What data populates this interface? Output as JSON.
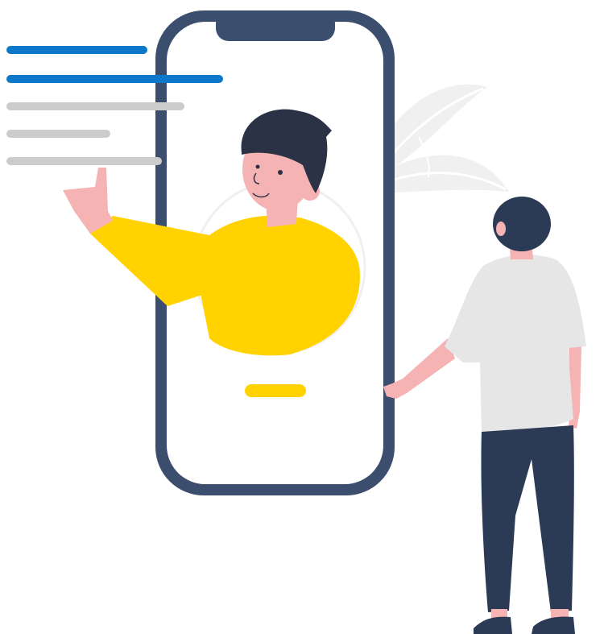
{
  "illustration": {
    "palette": {
      "phone_frame": "#3b4e6e",
      "screen": "#ffffff",
      "accent_blue": "#0d77c9",
      "text_line_gray": "#cccccc",
      "shirt_yellow": "#ffd200",
      "skin": "#f6b3b3",
      "hair_dark": "#2b3245",
      "pants_navy": "#2b3b55",
      "shirt_light": "#e6e6e6",
      "leaf_gray": "#f0f0f0"
    },
    "text_lines": [
      {
        "kind": "highlight",
        "color": "#0d77c9"
      },
      {
        "kind": "highlight",
        "color": "#0d77c9"
      },
      {
        "kind": "plain",
        "color": "#cccccc"
      },
      {
        "kind": "plain",
        "color": "#cccccc"
      },
      {
        "kind": "plain",
        "color": "#cccccc"
      }
    ]
  }
}
